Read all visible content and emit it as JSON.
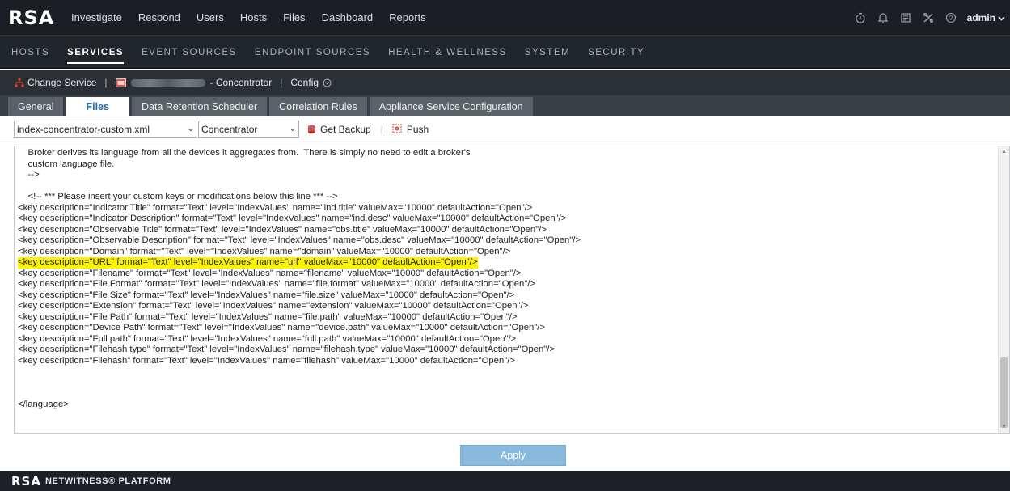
{
  "brand": {
    "logo": "RSA"
  },
  "main_nav": {
    "items": [
      "Investigate",
      "Respond",
      "Users",
      "Hosts",
      "Files",
      "Dashboard",
      "Reports"
    ]
  },
  "top_right": {
    "icons": [
      "timer-icon",
      "bell-icon",
      "notes-icon",
      "tools-icon",
      "help-icon"
    ],
    "user": "admin"
  },
  "sub_nav": {
    "items": [
      "HOSTS",
      "SERVICES",
      "EVENT SOURCES",
      "ENDPOINT SOURCES",
      "HEALTH & WELLNESS",
      "SYSTEM",
      "SECURITY"
    ],
    "active": "SERVICES"
  },
  "service_bar": {
    "change_service": "Change Service",
    "service_suffix": "- Concentrator",
    "config": "Config"
  },
  "tabs": {
    "items": [
      "General",
      "Files",
      "Data Retention Scheduler",
      "Correlation Rules",
      "Appliance Service Configuration"
    ],
    "active": "Files"
  },
  "toolbar": {
    "file_select": "index-concentrator-custom.xml",
    "service_select": "Concentrator",
    "get_backup": "Get Backup",
    "push": "Push"
  },
  "editor": {
    "lines": [
      "    Broker derives its language from all the devices it aggregates from.  There is simply no need to edit a broker's",
      "    custom language file.",
      "    -->",
      "",
      "    <!-- *** Please insert your custom keys or modifications below this line *** -->",
      "<key description=\"Indicator Title\" format=\"Text\" level=\"IndexValues\" name=\"ind.title\" valueMax=\"10000\" defaultAction=\"Open\"/>",
      "<key description=\"Indicator Description\" format=\"Text\" level=\"IndexValues\" name=\"ind.desc\" valueMax=\"10000\" defaultAction=\"Open\"/>",
      "<key description=\"Observable Title\" format=\"Text\" level=\"IndexValues\" name=\"obs.title\" valueMax=\"10000\" defaultAction=\"Open\"/>",
      "<key description=\"Observable Description\" format=\"Text\" level=\"IndexValues\" name=\"obs.desc\" valueMax=\"10000\" defaultAction=\"Open\"/>",
      "<key description=\"Domain\" format=\"Text\" level=\"IndexValues\" name=\"domain\" valueMax=\"10000\" defaultAction=\"Open\"/>",
      "<key description=\"URL\" format=\"Text\" level=\"IndexValues\" name=\"url\" valueMax=\"10000\" defaultAction=\"Open\"/>",
      "<key description=\"Filename\" format=\"Text\" level=\"IndexValues\" name=\"filename\" valueMax=\"10000\" defaultAction=\"Open\"/>",
      "<key description=\"File Format\" format=\"Text\" level=\"IndexValues\" name=\"file.format\" valueMax=\"10000\" defaultAction=\"Open\"/>",
      "<key description=\"File Size\" format=\"Text\" level=\"IndexValues\" name=\"file.size\" valueMax=\"10000\" defaultAction=\"Open\"/>",
      "<key description=\"Extension\" format=\"Text\" level=\"IndexValues\" name=\"extension\" valueMax=\"10000\" defaultAction=\"Open\"/>",
      "<key description=\"File Path\" format=\"Text\" level=\"IndexValues\" name=\"file.path\" valueMax=\"10000\" defaultAction=\"Open\"/>",
      "<key description=\"Device Path\" format=\"Text\" level=\"IndexValues\" name=\"device.path\" valueMax=\"10000\" defaultAction=\"Open\"/>",
      "<key description=\"Full path\" format=\"Text\" level=\"IndexValues\" name=\"full.path\" valueMax=\"10000\" defaultAction=\"Open\"/>",
      "<key description=\"Filehash type\" format=\"Text\" level=\"IndexValues\" name=\"filehash.type\" valueMax=\"10000\" defaultAction=\"Open\"/>",
      "<key description=\"Filehash\" format=\"Text\" level=\"IndexValues\" name=\"filehash\" valueMax=\"10000\" defaultAction=\"Open\"/>",
      "",
      "",
      "",
      "</language>"
    ],
    "highlighted_line_index": 10
  },
  "actions": {
    "apply": "Apply"
  },
  "footer": {
    "brand": "RSA",
    "product": "NETWITNESS® PLATFORM"
  },
  "colors": {
    "topbar": "#1b1e24",
    "subnav": "#21262d",
    "active_tab_text": "#1d6fb8",
    "highlight": "#fff200",
    "apply_button": "#8ab9de"
  }
}
